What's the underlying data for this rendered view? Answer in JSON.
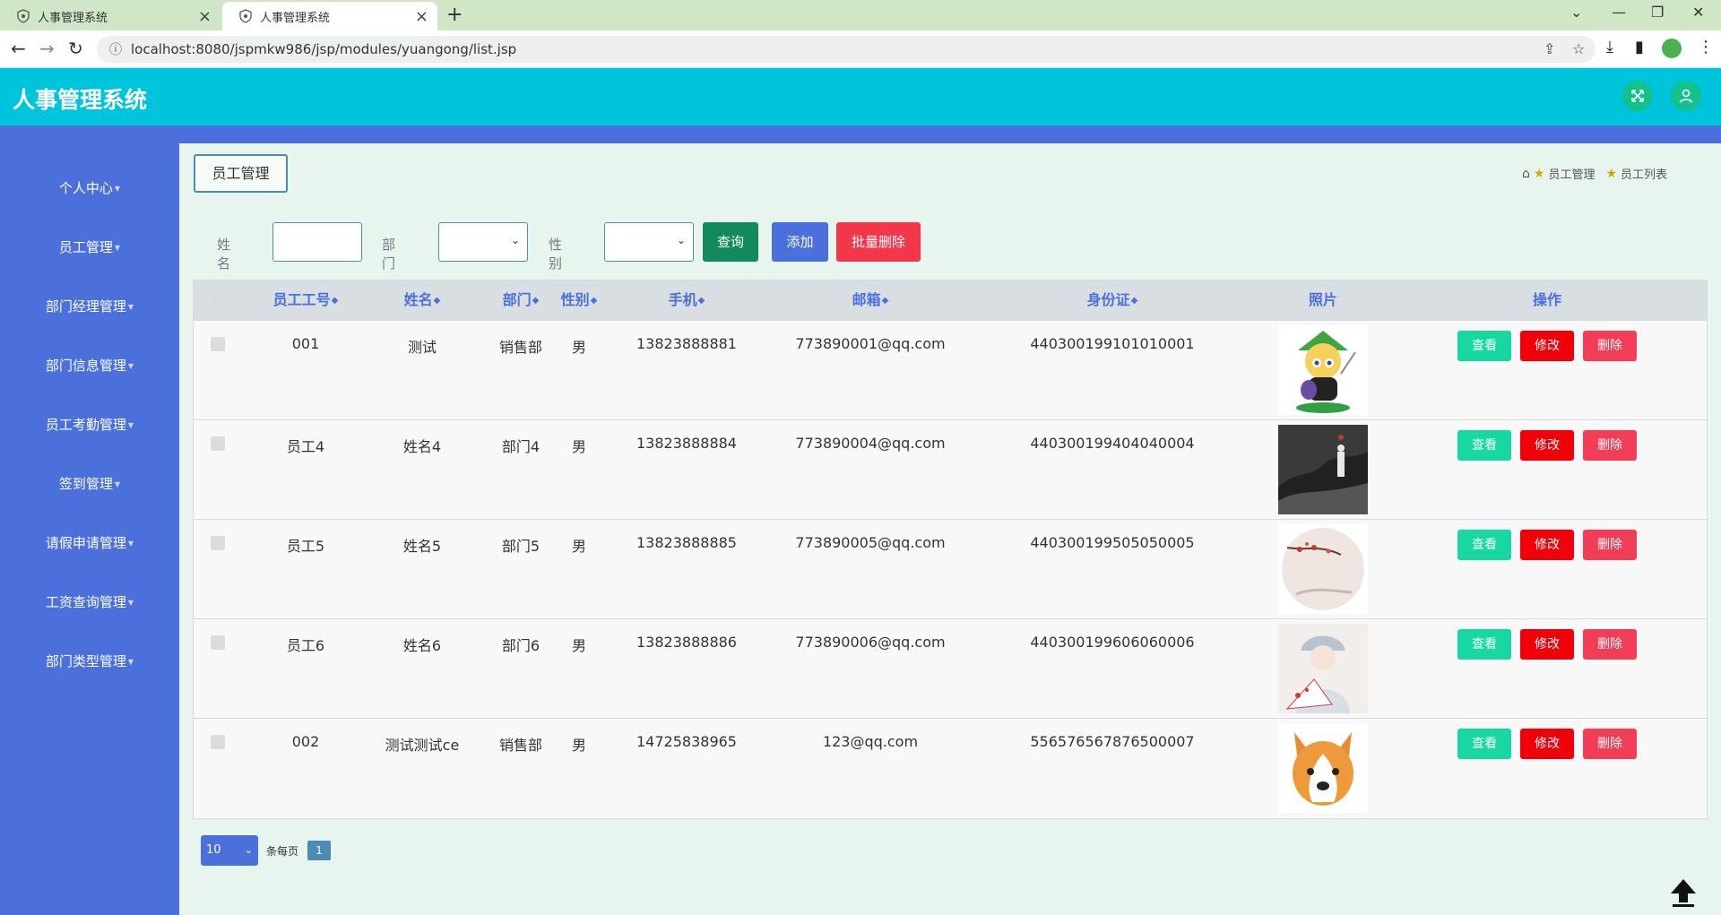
{
  "browser": {
    "tabs": [
      {
        "title": "人事管理系统"
      },
      {
        "title": "人事管理系统"
      }
    ],
    "url": "localhost:8080/jspmkw986/jsp/modules/yuangong/list.jsp"
  },
  "app": {
    "title": "人事管理系统"
  },
  "sidebar": {
    "items": [
      {
        "label": "个人中心"
      },
      {
        "label": "员工管理"
      },
      {
        "label": "部门经理管理"
      },
      {
        "label": "部门信息管理"
      },
      {
        "label": "员工考勤管理"
      },
      {
        "label": "签到管理"
      },
      {
        "label": "请假申请管理"
      },
      {
        "label": "工资查询管理"
      },
      {
        "label": "部门类型管理"
      }
    ]
  },
  "main": {
    "section_title": "员工管理",
    "breadcrumb": [
      "员工管理",
      "员工列表"
    ]
  },
  "search": {
    "name_label": "姓名",
    "dept_label": "部门",
    "gender_label": "性别",
    "query_button": "查询",
    "add_button": "添加",
    "batch_delete_button": "批量删除"
  },
  "table": {
    "headers": [
      "员工工号",
      "姓名",
      "部门",
      "性别",
      "手机",
      "邮箱",
      "身份证",
      "照片",
      "操作"
    ],
    "rows": [
      {
        "id": "001",
        "name": "测试",
        "dept": "销售部",
        "gender": "男",
        "phone": "13823888881",
        "email": "773890001@qq.com",
        "idcard": "440300199101010001",
        "photo": "cartoon-link-avatar"
      },
      {
        "id": "员工4",
        "name": "姓名4",
        "dept": "部门4",
        "gender": "男",
        "phone": "13823888884",
        "email": "773890004@qq.com",
        "idcard": "440300199404040004",
        "photo": "ink-landscape-figure"
      },
      {
        "id": "员工5",
        "name": "姓名5",
        "dept": "部门5",
        "gender": "男",
        "phone": "13823888885",
        "email": "773890005@qq.com",
        "idcard": "440300199505050005",
        "photo": "plum-blossom-circle"
      },
      {
        "id": "员工6",
        "name": "姓名6",
        "dept": "部门6",
        "gender": "男",
        "phone": "13823888886",
        "email": "773890006@qq.com",
        "idcard": "440300199606060006",
        "photo": "opera-portrait"
      },
      {
        "id": "002",
        "name": "测试测试ce",
        "dept": "销售部",
        "gender": "男",
        "phone": "14725838965",
        "email": "123@qq.com",
        "idcard": "556576567876500007",
        "photo": "corgi-face"
      }
    ],
    "actions": {
      "view": "查看",
      "edit": "修改",
      "delete": "删除"
    }
  },
  "pagination": {
    "page_size": "10",
    "per_page_text": "条每页",
    "current_page": "1"
  },
  "colors": {
    "header": "#00c4dc",
    "sidebar": "#4b70dc",
    "view": "#16d8a0",
    "edit": "#f2000a",
    "delete": "#f23d57"
  }
}
